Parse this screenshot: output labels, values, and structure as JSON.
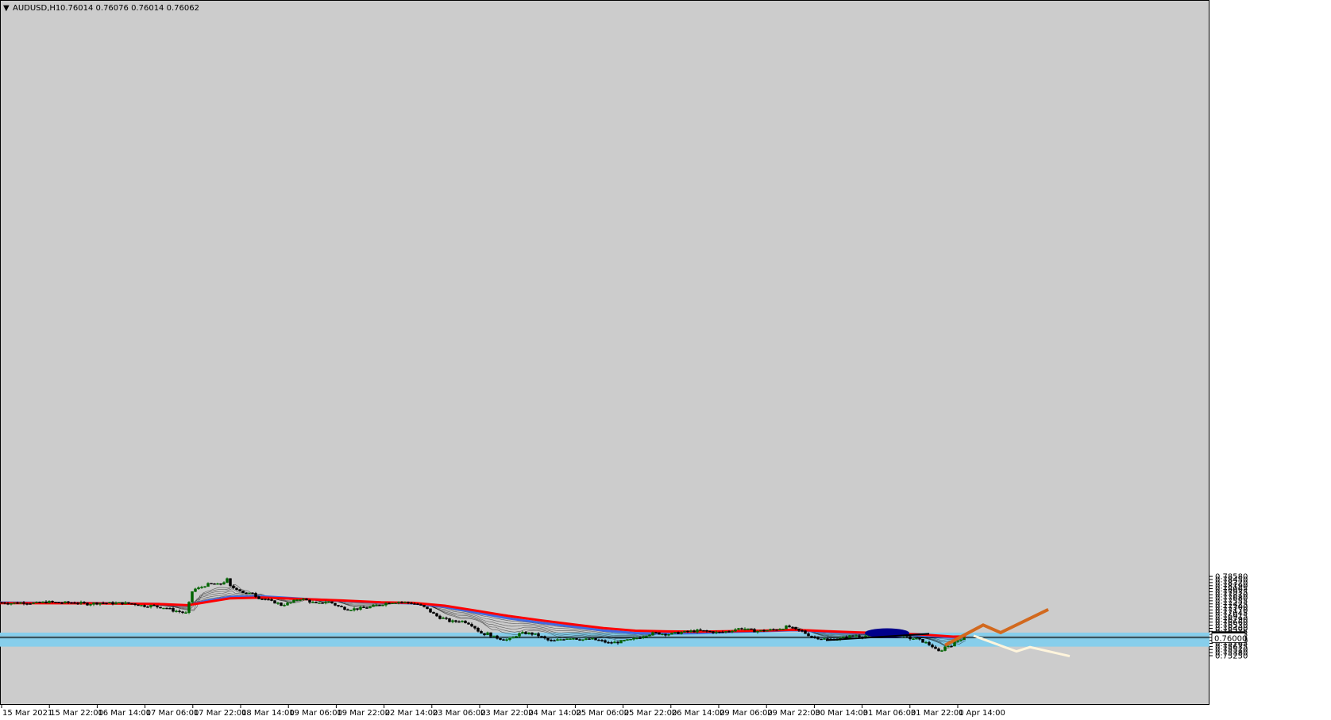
{
  "window": {
    "symbol_label": "AUDUSD,H1",
    "ohlc_text": "0.76014 0.76076 0.76014 0.76062"
  },
  "colors": {
    "chart_bg": "#cccccc",
    "zone": "#87ceeb",
    "bull": "#006400",
    "bear": "#000000",
    "ema_fast": "#000000",
    "ma_blue": "#4169e1",
    "ma_red": "#ff0000",
    "projection_up": "#d2691e",
    "projection_down": "#fff5dc",
    "trendline": "#000000",
    "marker": "#00008b"
  },
  "chart_data": {
    "type": "candlestick",
    "symbol": "AUDUSD",
    "timeframe": "H1",
    "last_price": 0.76062,
    "price_tags": [
      {
        "label": "0.76062",
        "value": 0.76062,
        "style": "dark"
      },
      {
        "label": "0.76000",
        "value": 0.76,
        "style": "light"
      }
    ],
    "hlines": [
      0.76062,
      0.76
    ],
    "ylim": [
      0.7522,
      0.7867
    ],
    "y_ticks": [
      "0.78580",
      "0.78450",
      "0.78320",
      "0.78190",
      "0.78065",
      "0.77935",
      "0.77810",
      "0.77680",
      "0.77555",
      "0.77425",
      "0.77300",
      "0.77170",
      "0.77045",
      "0.76915",
      "0.76790",
      "0.76660",
      "0.76530",
      "0.76400",
      "0.76275",
      "0.76145",
      "0.76015",
      "0.75890",
      "0.75765",
      "0.75635",
      "0.75510",
      "0.75380",
      "0.75250"
    ],
    "x_ticks": [
      "15 Mar 2021",
      "15 Mar 22:00",
      "16 Mar 14:00",
      "17 Mar 06:00",
      "17 Mar 22:00",
      "18 Mar 14:00",
      "19 Mar 06:00",
      "19 Mar 22:00",
      "22 Mar 14:00",
      "23 Mar 06:00",
      "23 Mar 22:00",
      "24 Mar 14:00",
      "25 Mar 06:00",
      "25 Mar 22:00",
      "26 Mar 14:00",
      "29 Mar 06:00",
      "29 Mar 22:00",
      "30 Mar 14:00",
      "31 Mar 06:00",
      "31 Mar 22:00",
      "1 Apr 14:00"
    ],
    "support_zone": [
      0.7563,
      0.7622
    ],
    "price_path": [
      [
        0,
        0.7748
      ],
      [
        15,
        0.7745
      ],
      [
        30,
        0.7748
      ],
      [
        45,
        0.7745
      ],
      [
        60,
        0.7751
      ],
      [
        75,
        0.7747
      ],
      [
        95,
        0.7748
      ],
      [
        110,
        0.7742
      ],
      [
        125,
        0.7747
      ],
      [
        140,
        0.7745
      ],
      [
        155,
        0.7746
      ],
      [
        170,
        0.7742
      ],
      [
        180,
        0.7734
      ],
      [
        190,
        0.7735
      ],
      [
        200,
        0.773
      ],
      [
        210,
        0.7725
      ],
      [
        218,
        0.7715
      ],
      [
        226,
        0.771
      ],
      [
        234,
        0.7703
      ],
      [
        238,
        0.7745
      ],
      [
        242,
        0.7795
      ],
      [
        246,
        0.7805
      ],
      [
        252,
        0.781
      ],
      [
        258,
        0.782
      ],
      [
        264,
        0.7826
      ],
      [
        270,
        0.7825
      ],
      [
        276,
        0.7822
      ],
      [
        282,
        0.7835
      ],
      [
        286,
        0.7845
      ],
      [
        290,
        0.7815
      ],
      [
        294,
        0.781
      ],
      [
        300,
        0.7805
      ],
      [
        306,
        0.779
      ],
      [
        312,
        0.7782
      ],
      [
        318,
        0.779
      ],
      [
        324,
        0.777
      ],
      [
        330,
        0.7765
      ],
      [
        336,
        0.776
      ],
      [
        342,
        0.7752
      ],
      [
        348,
        0.7748
      ],
      [
        354,
        0.7738
      ],
      [
        360,
        0.7742
      ],
      [
        368,
        0.775
      ],
      [
        376,
        0.7765
      ],
      [
        384,
        0.776
      ],
      [
        392,
        0.775
      ],
      [
        400,
        0.774
      ],
      [
        408,
        0.7752
      ],
      [
        416,
        0.775
      ],
      [
        424,
        0.7735
      ],
      [
        432,
        0.7725
      ],
      [
        440,
        0.772
      ],
      [
        448,
        0.7722
      ],
      [
        456,
        0.7725
      ],
      [
        464,
        0.7728
      ],
      [
        472,
        0.7735
      ],
      [
        480,
        0.774
      ],
      [
        488,
        0.7748
      ],
      [
        496,
        0.775
      ],
      [
        504,
        0.7752
      ],
      [
        512,
        0.7748
      ],
      [
        520,
        0.7745
      ],
      [
        528,
        0.7738
      ],
      [
        536,
        0.7725
      ],
      [
        542,
        0.771
      ],
      [
        548,
        0.7695
      ],
      [
        554,
        0.7685
      ],
      [
        560,
        0.768
      ],
      [
        566,
        0.767
      ],
      [
        572,
        0.7668
      ],
      [
        580,
        0.7672
      ],
      [
        588,
        0.7665
      ],
      [
        596,
        0.765
      ],
      [
        602,
        0.763
      ],
      [
        608,
        0.7615
      ],
      [
        614,
        0.7618
      ],
      [
        620,
        0.7605
      ],
      [
        626,
        0.76
      ],
      [
        632,
        0.7595
      ],
      [
        638,
        0.7592
      ],
      [
        646,
        0.76
      ],
      [
        652,
        0.7615
      ],
      [
        660,
        0.762
      ],
      [
        668,
        0.7618
      ],
      [
        676,
        0.7612
      ],
      [
        684,
        0.76
      ],
      [
        690,
        0.759
      ],
      [
        696,
        0.7585
      ],
      [
        704,
        0.7592
      ],
      [
        712,
        0.7598
      ],
      [
        720,
        0.76
      ],
      [
        728,
        0.7595
      ],
      [
        736,
        0.7592
      ],
      [
        744,
        0.7595
      ],
      [
        752,
        0.759
      ],
      [
        760,
        0.7585
      ],
      [
        766,
        0.7578
      ],
      [
        772,
        0.758
      ],
      [
        780,
        0.7583
      ],
      [
        788,
        0.7588
      ],
      [
        796,
        0.7592
      ],
      [
        802,
        0.76
      ],
      [
        808,
        0.7605
      ],
      [
        816,
        0.7615
      ],
      [
        824,
        0.762
      ],
      [
        832,
        0.7618
      ],
      [
        840,
        0.7615
      ],
      [
        848,
        0.7618
      ],
      [
        856,
        0.7622
      ],
      [
        864,
        0.7625
      ],
      [
        872,
        0.7628
      ],
      [
        880,
        0.763
      ],
      [
        888,
        0.7628
      ],
      [
        896,
        0.7625
      ],
      [
        904,
        0.7622
      ],
      [
        912,
        0.7625
      ],
      [
        920,
        0.763
      ],
      [
        928,
        0.7638
      ],
      [
        936,
        0.764
      ],
      [
        944,
        0.7632
      ],
      [
        952,
        0.7628
      ],
      [
        960,
        0.763
      ],
      [
        968,
        0.7632
      ],
      [
        976,
        0.7635
      ],
      [
        984,
        0.764
      ],
      [
        992,
        0.7648
      ],
      [
        998,
        0.764
      ],
      [
        1004,
        0.763
      ],
      [
        1010,
        0.7628
      ],
      [
        1016,
        0.7615
      ],
      [
        1022,
        0.7605
      ],
      [
        1030,
        0.76
      ],
      [
        1038,
        0.7595
      ],
      [
        1046,
        0.7592
      ],
      [
        1054,
        0.7596
      ],
      [
        1062,
        0.76
      ],
      [
        1070,
        0.7606
      ],
      [
        1078,
        0.761
      ],
      [
        1086,
        0.7605
      ],
      [
        1094,
        0.7612
      ],
      [
        1102,
        0.7616
      ],
      [
        1110,
        0.7614
      ],
      [
        1118,
        0.7618
      ],
      [
        1126,
        0.7615
      ],
      [
        1134,
        0.761
      ],
      [
        1140,
        0.7603
      ],
      [
        1146,
        0.7598
      ],
      [
        1152,
        0.7596
      ],
      [
        1158,
        0.759
      ],
      [
        1164,
        0.7582
      ],
      [
        1170,
        0.7572
      ],
      [
        1176,
        0.756
      ],
      [
        1180,
        0.754
      ],
      [
        1184,
        0.7545
      ],
      [
        1188,
        0.7555
      ],
      [
        1192,
        0.7568
      ],
      [
        1196,
        0.7565
      ],
      [
        1200,
        0.7575
      ],
      [
        1206,
        0.759
      ],
      [
        1212,
        0.76
      ],
      [
        1216,
        0.7606
      ]
    ],
    "ma_blue_path": [
      [
        0,
        0.7748
      ],
      [
        120,
        0.7746
      ],
      [
        200,
        0.7742
      ],
      [
        236,
        0.7736
      ],
      [
        260,
        0.7755
      ],
      [
        290,
        0.7772
      ],
      [
        330,
        0.7774
      ],
      [
        380,
        0.7764
      ],
      [
        430,
        0.7756
      ],
      [
        480,
        0.7748
      ],
      [
        520,
        0.7745
      ],
      [
        560,
        0.773
      ],
      [
        600,
        0.7706
      ],
      [
        640,
        0.7682
      ],
      [
        680,
        0.7664
      ],
      [
        720,
        0.7648
      ],
      [
        760,
        0.7631
      ],
      [
        800,
        0.762
      ],
      [
        840,
        0.7618
      ],
      [
        880,
        0.762
      ],
      [
        920,
        0.7625
      ],
      [
        960,
        0.7628
      ],
      [
        1000,
        0.7632
      ],
      [
        1040,
        0.7625
      ],
      [
        1080,
        0.762
      ],
      [
        1120,
        0.7616
      ],
      [
        1160,
        0.761
      ],
      [
        1200,
        0.7601
      ],
      [
        1216,
        0.7602
      ]
    ],
    "ma_red_path": [
      [
        0,
        0.7746
      ],
      [
        120,
        0.7745
      ],
      [
        200,
        0.7742
      ],
      [
        236,
        0.7737
      ],
      [
        260,
        0.775
      ],
      [
        290,
        0.7766
      ],
      [
        330,
        0.7769
      ],
      [
        380,
        0.7763
      ],
      [
        430,
        0.7757
      ],
      [
        480,
        0.7749
      ],
      [
        520,
        0.7747
      ],
      [
        560,
        0.7735
      ],
      [
        600,
        0.7714
      ],
      [
        640,
        0.7692
      ],
      [
        680,
        0.7674
      ],
      [
        720,
        0.7657
      ],
      [
        760,
        0.7641
      ],
      [
        800,
        0.763
      ],
      [
        840,
        0.7627
      ],
      [
        880,
        0.7626
      ],
      [
        920,
        0.7628
      ],
      [
        960,
        0.763
      ],
      [
        1000,
        0.7634
      ],
      [
        1040,
        0.7628
      ],
      [
        1080,
        0.7623
      ],
      [
        1120,
        0.7619
      ],
      [
        1160,
        0.7614
      ],
      [
        1200,
        0.7605
      ],
      [
        1216,
        0.7606
      ]
    ],
    "trendline": [
      [
        1040,
        0.759
      ],
      [
        1170,
        0.7617
      ]
    ],
    "marker_ellipse": {
      "center": [
        1117,
        0.762
      ]
    },
    "projection_up": [
      [
        1190,
        0.7569
      ],
      [
        1238,
        0.7654
      ],
      [
        1260,
        0.7622
      ],
      [
        1320,
        0.7719
      ]
    ],
    "projection_down": [
      [
        1226,
        0.7609
      ],
      [
        1280,
        0.7543
      ],
      [
        1297,
        0.7561
      ],
      [
        1347,
        0.7523
      ]
    ]
  }
}
